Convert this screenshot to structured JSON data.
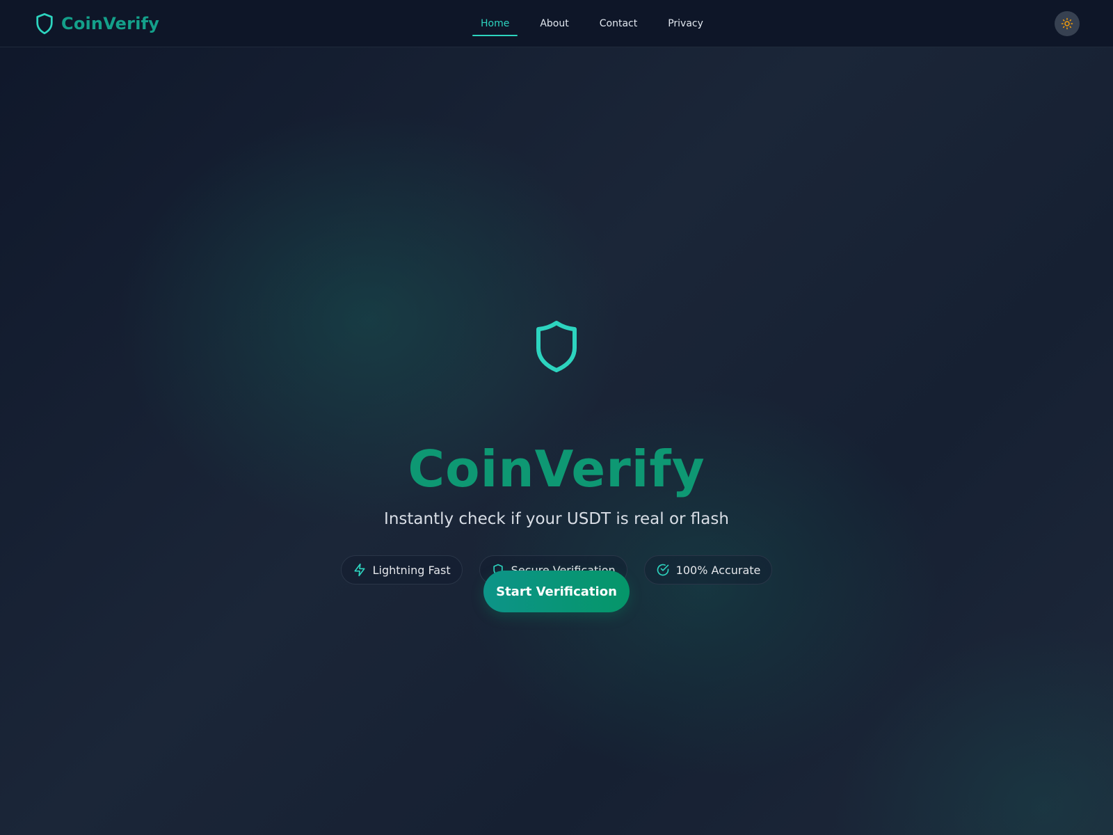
{
  "brand": {
    "name": "CoinVerify",
    "icon": "shield-icon",
    "color": "#14a08a"
  },
  "nav": {
    "items": [
      {
        "label": "Home",
        "active": true
      },
      {
        "label": "About",
        "active": false
      },
      {
        "label": "Contact",
        "active": false
      },
      {
        "label": "Privacy",
        "active": false
      }
    ],
    "active_color": "#2dd4bf"
  },
  "theme_toggle": {
    "icon": "sun-icon",
    "icon_color": "#f59e0b"
  },
  "hero": {
    "icon": "shield-icon",
    "title": "CoinVerify",
    "subtitle": "Instantly check if your USDT is real or flash",
    "features": [
      {
        "label": "Lightning Fast",
        "icon": "lightning-icon"
      },
      {
        "label": "Secure Verification",
        "icon": "shield-icon"
      },
      {
        "label": "100% Accurate",
        "icon": "check-circle-icon"
      }
    ],
    "cta_label": "Start Verification"
  },
  "colors": {
    "accent": "#2dd4bf",
    "title_green": "#0e9873",
    "background": "#151d2c"
  }
}
